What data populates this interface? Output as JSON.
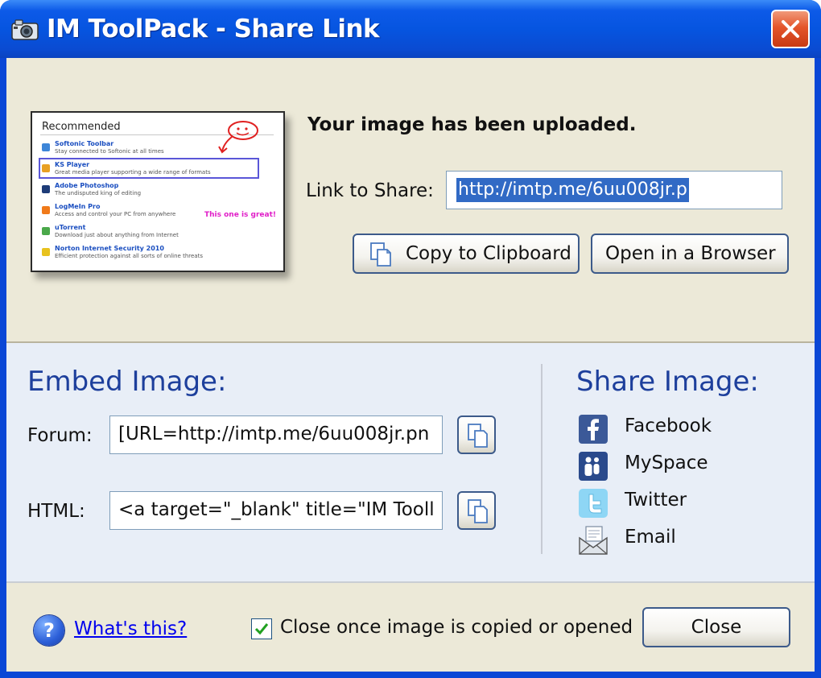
{
  "window": {
    "title": "IM ToolPack - Share Link",
    "close_glyph": "X"
  },
  "preview": {
    "heading": "Recommended",
    "items": [
      {
        "name": "Softonic Toolbar",
        "desc": "Stay connected to Softonic at all times"
      },
      {
        "name": "KS Player",
        "desc": "Great media player supporting a wide range of formats"
      },
      {
        "name": "Adobe Photoshop",
        "desc": "The undisputed king of          editing"
      },
      {
        "name": "LogMeIn Pro",
        "desc": "Access and control your PC from anywhere"
      },
      {
        "name": "uTorrent",
        "desc": "Download just about anything from Internet"
      },
      {
        "name": "Norton Internet Security 2010",
        "desc": "Efficient protection against all sorts of online threats"
      }
    ],
    "annotation": "This one is great!"
  },
  "upload": {
    "message": "Your image has been uploaded.",
    "link_label": "Link to Share:",
    "link_value": "http://imtp.me/6uu008jr.p",
    "copy_button": "Copy to Clipboard",
    "open_button": "Open in a Browser"
  },
  "embed": {
    "title": "Embed Image:",
    "forum_label": "Forum:",
    "forum_value": "[URL=http://imtp.me/6uu008jr.pn",
    "html_label": "HTML:",
    "html_value": "<a target=\"_blank\" title=\"IM Tooll"
  },
  "share": {
    "title": "Share Image:",
    "items": [
      {
        "label": "Facebook",
        "icon": "facebook-icon"
      },
      {
        "label": "MySpace",
        "icon": "myspace-icon"
      },
      {
        "label": "Twitter",
        "icon": "twitter-icon"
      },
      {
        "label": "Email",
        "icon": "email-icon"
      }
    ]
  },
  "footer": {
    "help_glyph": "?",
    "whats_this": "What's this?",
    "checkbox_label": "Close once image is copied or opened",
    "checkbox_checked": true,
    "close_button": "Close"
  }
}
